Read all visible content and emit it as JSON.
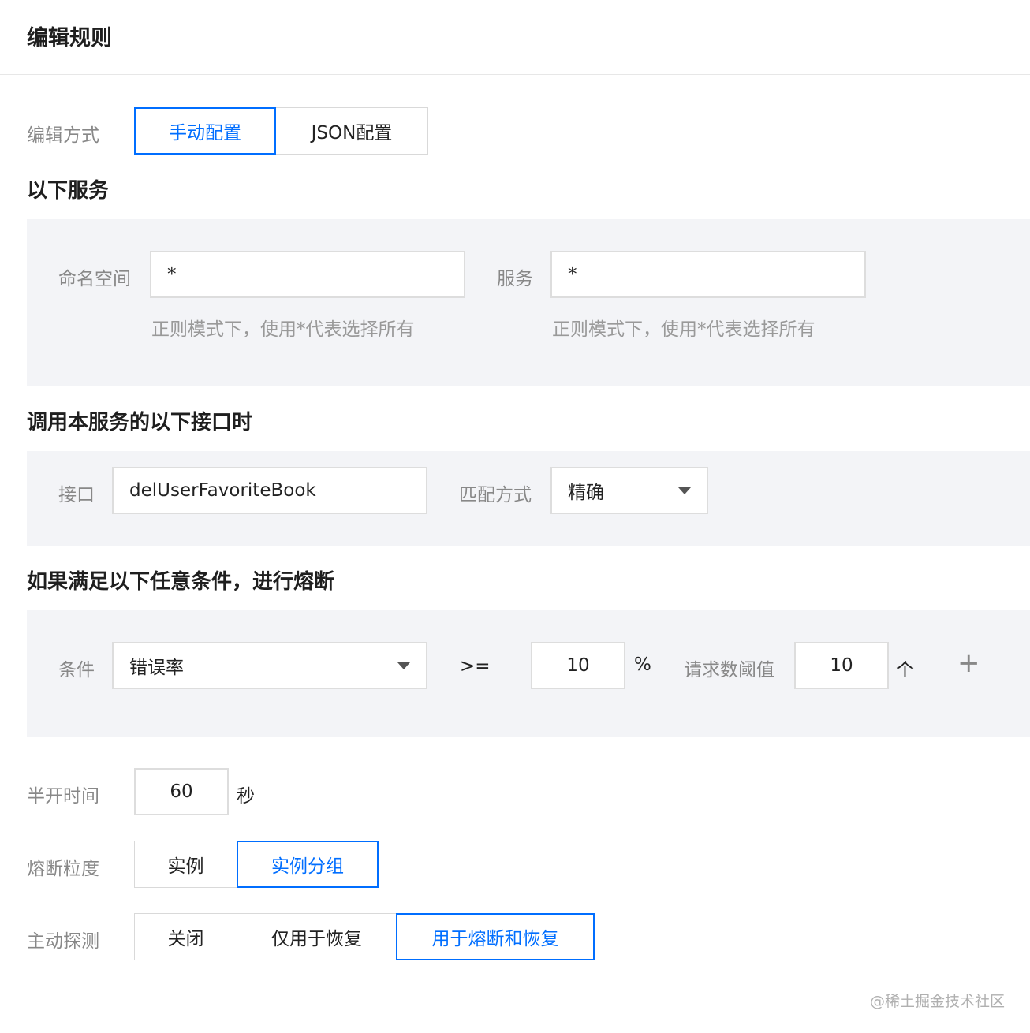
{
  "title": "编辑规则",
  "edit_mode": {
    "label": "编辑方式",
    "options": [
      "手动配置",
      "JSON配置"
    ],
    "selected": "手动配置"
  },
  "services": {
    "section_title": "以下服务",
    "namespace_label": "命名空间",
    "namespace_value": "*",
    "namespace_hint": "正则模式下，使用*代表选择所有",
    "service_label": "服务",
    "service_value": "*",
    "service_hint": "正则模式下，使用*代表选择所有"
  },
  "interface": {
    "section_title": "调用本服务的以下接口时",
    "interface_label": "接口",
    "interface_value": "delUserFavoriteBook",
    "match_label": "匹配方式",
    "match_value": "精确"
  },
  "conditions": {
    "section_title": "如果满足以下任意条件，进行熔断",
    "condition_label": "条件",
    "condition_value": "错误率",
    "operator": ">=",
    "threshold_value": "10",
    "threshold_unit": "%",
    "request_label": "请求数阈值",
    "request_value": "10",
    "request_unit": "个",
    "add_symbol": "+"
  },
  "half_open": {
    "label": "半开时间",
    "value": "60",
    "unit": "秒"
  },
  "granularity": {
    "label": "熔断粒度",
    "options": [
      "实例",
      "实例分组"
    ],
    "selected": "实例分组"
  },
  "probe": {
    "label": "主动探测",
    "options": [
      "关闭",
      "仅用于恢复",
      "用于熔断和恢复"
    ],
    "selected": "用于熔断和恢复"
  },
  "watermark": "@稀土掘金技术社区",
  "colors": {
    "accent": "#006eff",
    "panel_bg": "#f3f4f7",
    "label_gray": "#888888"
  }
}
